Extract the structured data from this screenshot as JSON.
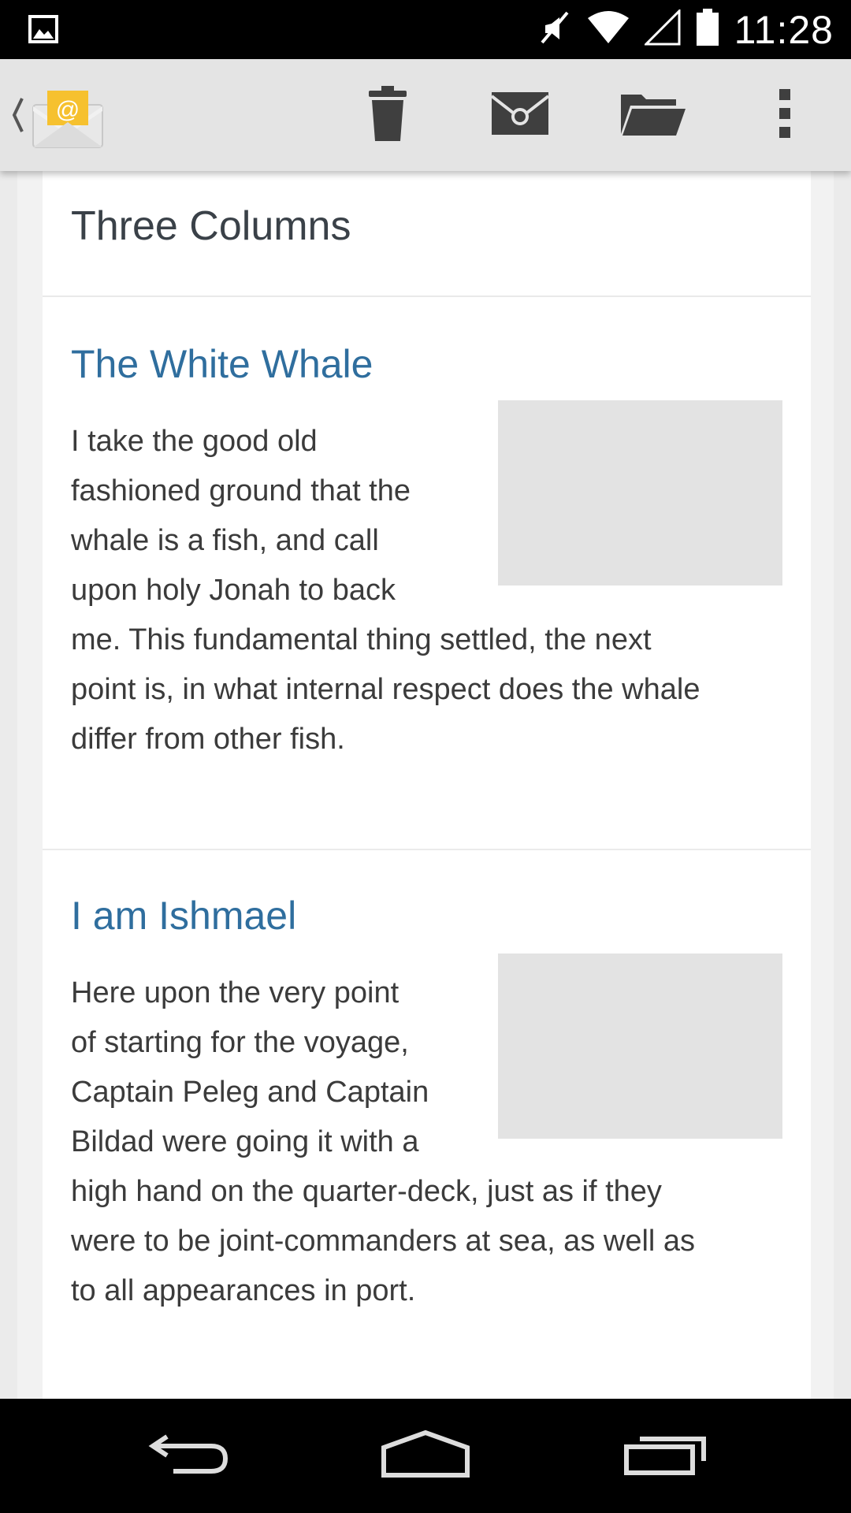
{
  "status_bar": {
    "time": "11:28",
    "icons": [
      "image-notification-icon",
      "mute-icon",
      "wifi-icon",
      "signal-icon",
      "battery-icon"
    ]
  },
  "action_bar": {
    "app_icon": "email-app-icon",
    "actions": [
      "trash-icon",
      "mark-unread-icon",
      "folder-icon",
      "overflow-menu-icon"
    ]
  },
  "message": {
    "header_title": "Three Columns",
    "sections": [
      {
        "title": "The White Whale",
        "text_wrapped": [
          "I take the good old",
          "fashioned ground that the",
          "whale is a fish, and call",
          "upon holy Jonah to back"
        ],
        "text_full": [
          "me. This fundamental thing settled, the next",
          "point is, in what internal respect does the whale",
          "differ from other fish."
        ]
      },
      {
        "title": "I am Ishmael",
        "text_wrapped": [
          "Here upon the very point",
          "of starting for the voyage,",
          "Captain Peleg and Captain",
          "Bildad were going it with a"
        ],
        "text_full": [
          "high hand on the quarter-deck, just as if they",
          "were to be joint-commanders at sea, as well as",
          "to all appearances in port."
        ]
      }
    ]
  },
  "nav_bar": [
    "back-icon",
    "home-icon",
    "recents-icon"
  ],
  "colors": {
    "accent_title": "#2f6e9e",
    "action_bar_bg": "#e4e4e4",
    "placeholder": "#e3e3e3"
  }
}
